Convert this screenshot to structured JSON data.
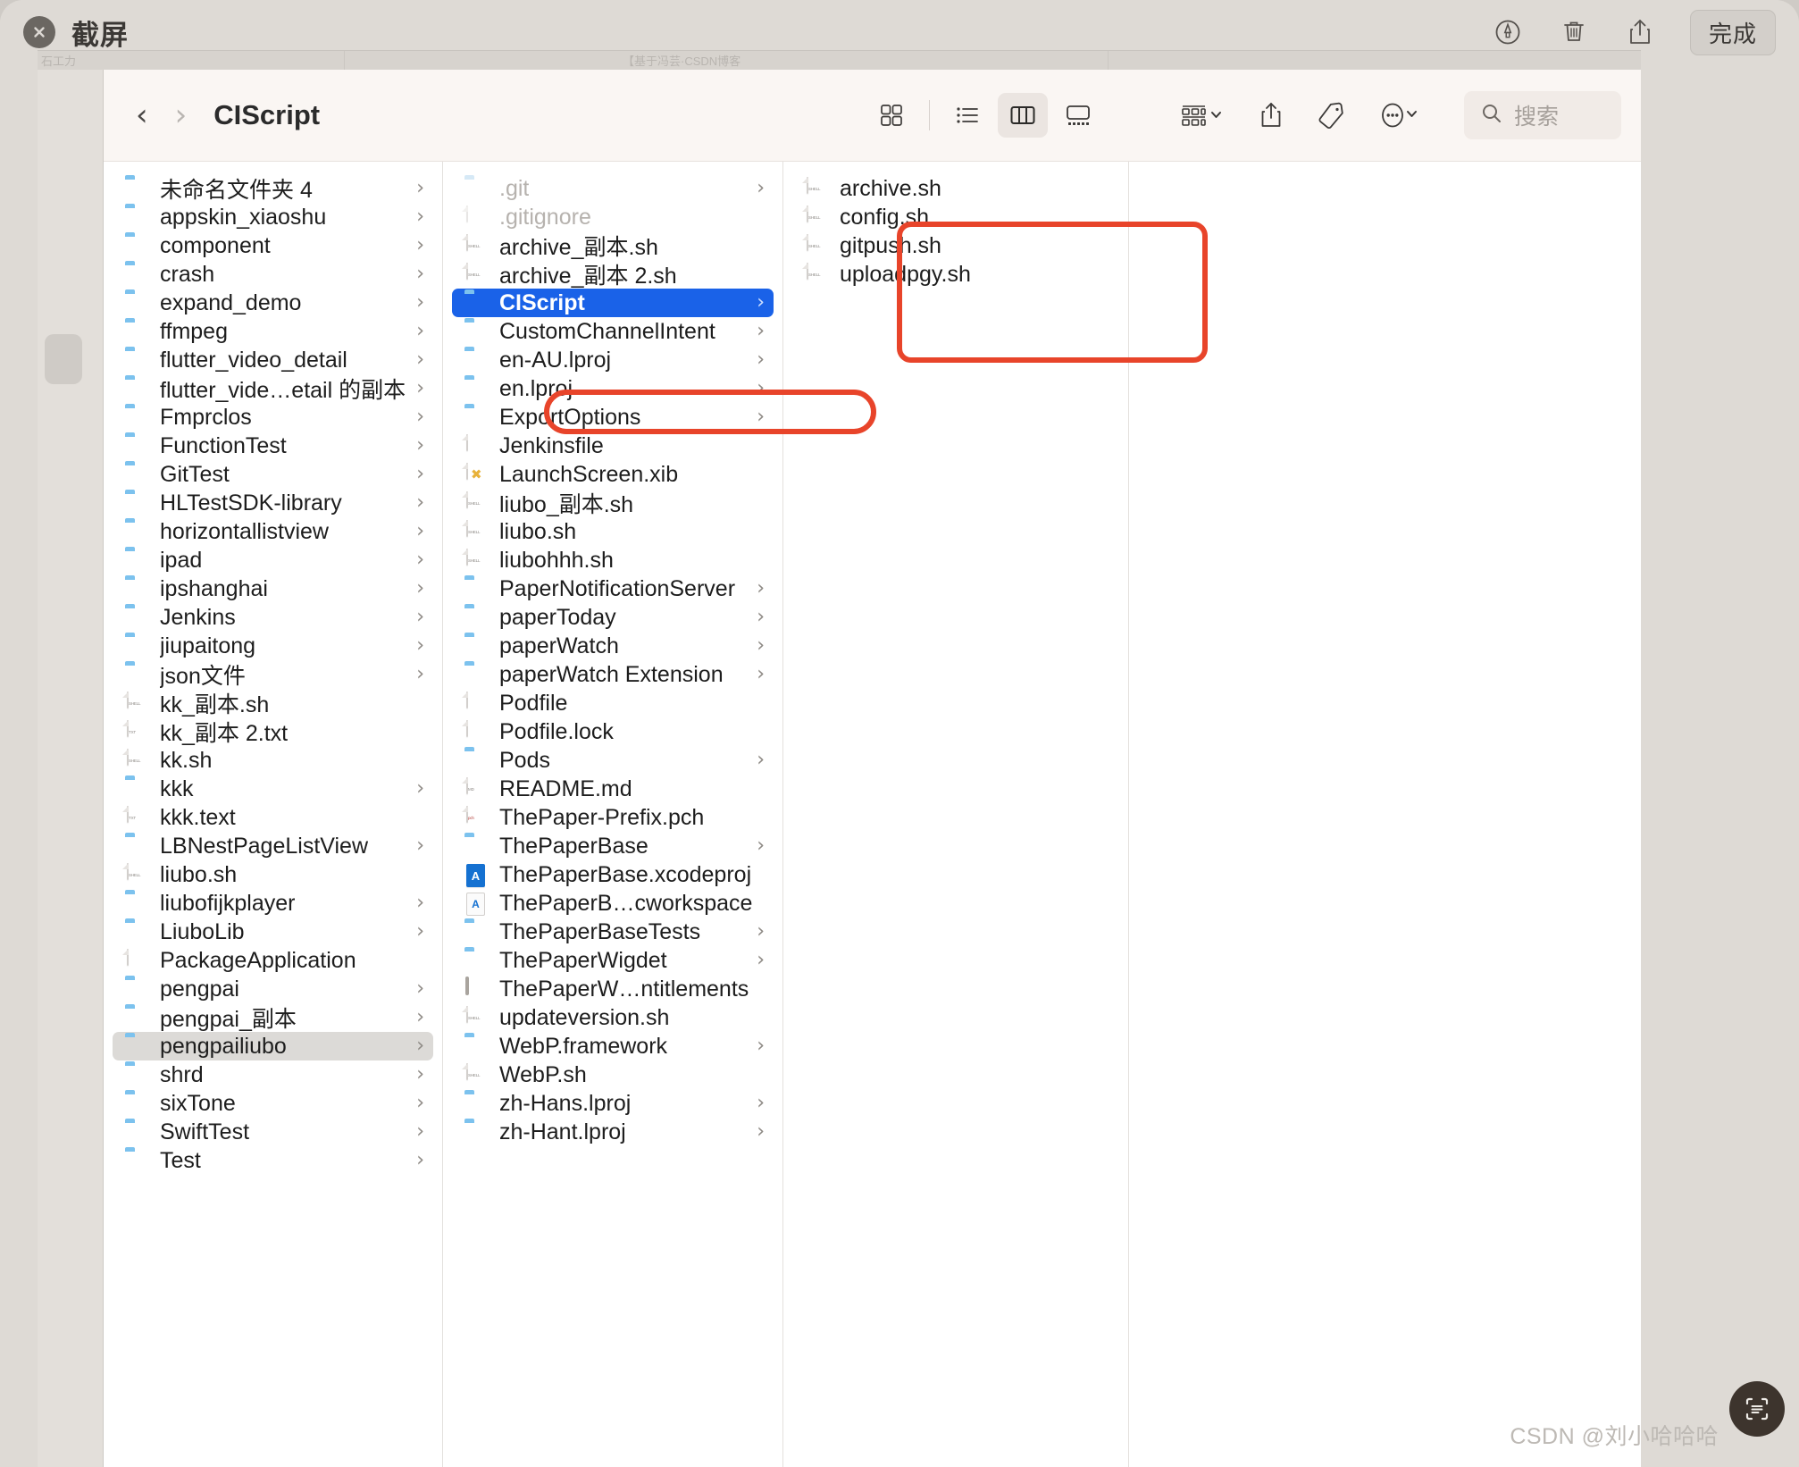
{
  "screenshot_app": {
    "title": "截屏",
    "close_icon": "close-icon",
    "actions": [
      {
        "name": "markup-icon",
        "label": "标记"
      },
      {
        "name": "trash-icon",
        "label": "删除"
      },
      {
        "name": "share-icon",
        "label": "共享"
      }
    ],
    "done_label": "完成"
  },
  "background_window": {
    "label_left": "石工力",
    "label_mid": "【基于冯芸·CSDN博客"
  },
  "finder": {
    "path_title": "CIScript",
    "back_label": "‹",
    "forward_label": "›",
    "view_modes": [
      {
        "name": "icon-view-button",
        "label": "图标显示",
        "active": false
      },
      {
        "name": "list-view-button",
        "label": "列表显示",
        "active": false
      },
      {
        "name": "column-view-button",
        "label": "分栏显示",
        "active": true
      },
      {
        "name": "gallery-view-button",
        "label": "画廊显示",
        "active": false
      }
    ],
    "group_button_label": "排序",
    "share_button_label": "共享",
    "tag_button_label": "标记",
    "more_button_label": "更多",
    "search": {
      "placeholder": "搜索",
      "value": ""
    }
  },
  "columns": [
    {
      "name": "column-1",
      "items": [
        {
          "label": "未命名文件夹 4",
          "icon": "folder",
          "disclosure": true
        },
        {
          "label": "appskin_xiaoshu",
          "icon": "folder",
          "disclosure": true
        },
        {
          "label": "component",
          "icon": "folder",
          "disclosure": true
        },
        {
          "label": "crash",
          "icon": "folder",
          "disclosure": true
        },
        {
          "label": "expand_demo",
          "icon": "folder",
          "disclosure": true
        },
        {
          "label": "ffmpeg",
          "icon": "folder",
          "disclosure": true
        },
        {
          "label": "flutter_video_detail",
          "icon": "folder",
          "disclosure": true
        },
        {
          "label": "flutter_vide…etail 的副本",
          "icon": "folder",
          "disclosure": true
        },
        {
          "label": "Fmprclos",
          "icon": "folder",
          "disclosure": true
        },
        {
          "label": "FunctionTest",
          "icon": "folder",
          "disclosure": true
        },
        {
          "label": "GitTest",
          "icon": "folder",
          "disclosure": true
        },
        {
          "label": "HLTestSDK-library",
          "icon": "folder",
          "disclosure": true
        },
        {
          "label": "horizontallistview",
          "icon": "folder",
          "disclosure": true
        },
        {
          "label": "ipad",
          "icon": "folder",
          "disclosure": true
        },
        {
          "label": "ipshanghai",
          "icon": "folder",
          "disclosure": true
        },
        {
          "label": "Jenkins",
          "icon": "folder",
          "disclosure": true
        },
        {
          "label": "jiupaitong",
          "icon": "folder",
          "disclosure": true
        },
        {
          "label": "json文件",
          "icon": "folder",
          "disclosure": true
        },
        {
          "label": "kk_副本.sh",
          "icon": "shell",
          "disclosure": false
        },
        {
          "label": "kk_副本 2.txt",
          "icon": "txt",
          "disclosure": false
        },
        {
          "label": "kk.sh",
          "icon": "shell",
          "disclosure": false
        },
        {
          "label": "kkk",
          "icon": "folder",
          "disclosure": true
        },
        {
          "label": "kkk.text",
          "icon": "txt",
          "disclosure": false
        },
        {
          "label": "LBNestPageListView",
          "icon": "folder",
          "disclosure": true
        },
        {
          "label": "liubo.sh",
          "icon": "shell",
          "disclosure": false
        },
        {
          "label": "liubofijkplayer",
          "icon": "folder",
          "disclosure": true
        },
        {
          "label": "LiuboLib",
          "icon": "folder",
          "disclosure": true
        },
        {
          "label": "PackageApplication",
          "icon": "plain",
          "disclosure": false
        },
        {
          "label": "pengpai",
          "icon": "folder",
          "disclosure": true
        },
        {
          "label": "pengpai_副本",
          "icon": "folder",
          "disclosure": true
        },
        {
          "label": "pengpailiubo",
          "icon": "folder",
          "disclosure": true,
          "selected": "gray"
        },
        {
          "label": "shrd",
          "icon": "folder",
          "disclosure": true
        },
        {
          "label": "sixTone",
          "icon": "folder",
          "disclosure": true
        },
        {
          "label": "SwiftTest",
          "icon": "folder",
          "disclosure": true
        },
        {
          "label": "Test",
          "icon": "folder",
          "disclosure": true
        }
      ]
    },
    {
      "name": "column-2",
      "items": [
        {
          "label": ".git",
          "icon": "folder",
          "disclosure": true,
          "dimmed": true
        },
        {
          "label": ".gitignore",
          "icon": "plain",
          "disclosure": false,
          "dimmed": true
        },
        {
          "label": "archive_副本.sh",
          "icon": "shell",
          "disclosure": false
        },
        {
          "label": "archive_副本 2.sh",
          "icon": "shell",
          "disclosure": false
        },
        {
          "label": "CIScript",
          "icon": "folder",
          "disclosure": true,
          "selected": "blue"
        },
        {
          "label": "CustomChannelIntent",
          "icon": "folder",
          "disclosure": true
        },
        {
          "label": "en-AU.lproj",
          "icon": "folder",
          "disclosure": true
        },
        {
          "label": "en.lproj",
          "icon": "folder",
          "disclosure": true
        },
        {
          "label": "ExportOptions",
          "icon": "folder",
          "disclosure": true
        },
        {
          "label": "Jenkinsfile",
          "icon": "plain",
          "disclosure": false
        },
        {
          "label": "LaunchScreen.xib",
          "icon": "xib",
          "disclosure": false
        },
        {
          "label": "liubo_副本.sh",
          "icon": "shell",
          "disclosure": false
        },
        {
          "label": "liubo.sh",
          "icon": "shell",
          "disclosure": false
        },
        {
          "label": "liubohhh.sh",
          "icon": "shell",
          "disclosure": false
        },
        {
          "label": "PaperNotificationServer",
          "icon": "folder",
          "disclosure": true
        },
        {
          "label": "paperToday",
          "icon": "folder",
          "disclosure": true
        },
        {
          "label": "paperWatch",
          "icon": "folder",
          "disclosure": true
        },
        {
          "label": "paperWatch Extension",
          "icon": "folder",
          "disclosure": true
        },
        {
          "label": "Podfile",
          "icon": "plain",
          "disclosure": false
        },
        {
          "label": "Podfile.lock",
          "icon": "plain",
          "disclosure": false
        },
        {
          "label": "Pods",
          "icon": "folder",
          "disclosure": true
        },
        {
          "label": "README.md",
          "icon": "md",
          "disclosure": false
        },
        {
          "label": "ThePaper-Prefix.pch",
          "icon": "pch",
          "disclosure": false
        },
        {
          "label": "ThePaperBase",
          "icon": "folder",
          "disclosure": true
        },
        {
          "label": "ThePaperBase.xcodeproj",
          "icon": "xcodeproj",
          "disclosure": false
        },
        {
          "label": "ThePaperB…cworkspace",
          "icon": "xcworkspace",
          "disclosure": false
        },
        {
          "label": "ThePaperBaseTests",
          "icon": "folder",
          "disclosure": true
        },
        {
          "label": "ThePaperWigdet",
          "icon": "folder",
          "disclosure": true
        },
        {
          "label": "ThePaperW…ntitlements",
          "icon": "cert",
          "disclosure": false
        },
        {
          "label": "updateversion.sh",
          "icon": "shell",
          "disclosure": false
        },
        {
          "label": "WebP.framework",
          "icon": "folder",
          "disclosure": true
        },
        {
          "label": "WebP.sh",
          "icon": "shell",
          "disclosure": false
        },
        {
          "label": "zh-Hans.lproj",
          "icon": "folder",
          "disclosure": true
        },
        {
          "label": "zh-Hant.lproj",
          "icon": "folder",
          "disclosure": true
        }
      ]
    },
    {
      "name": "column-3",
      "items": [
        {
          "label": "archive.sh",
          "icon": "shell",
          "disclosure": false
        },
        {
          "label": "config.sh",
          "icon": "shell",
          "disclosure": false
        },
        {
          "label": "gitpush.sh",
          "icon": "shell",
          "disclosure": false
        },
        {
          "label": "uploadpgy.sh",
          "icon": "shell",
          "disclosure": false
        }
      ]
    },
    {
      "name": "column-4",
      "items": []
    }
  ],
  "annotations": {
    "accent_color": "#e8442a",
    "boxes": [
      {
        "name": "annotation-ciscript",
        "target": "CIScript"
      },
      {
        "name": "annotation-ciscript-contents",
        "target": "column-3"
      }
    ]
  },
  "watermark": {
    "text": "CSDN @刘小哈哈哈"
  },
  "floating_button": {
    "name": "ocr-scan-button",
    "label": "文字识别"
  },
  "colors": {
    "selection_blue": "#1a62e8",
    "selection_gray": "#dcdad7",
    "folder_blue": "#63b4e8",
    "annotation_red": "#e8442a",
    "window_chrome": "#dedad5",
    "toolbar": "#faf6f3"
  }
}
